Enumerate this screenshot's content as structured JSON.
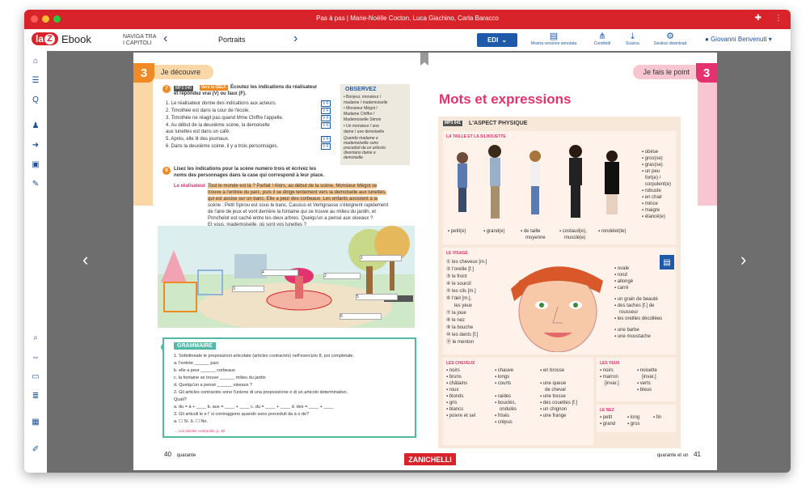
{
  "window": {
    "title": "Pas à pas | Marie-Noëlle Cocton, Luca Giachino, Carla Baracco"
  },
  "appbar": {
    "logo_la": "la",
    "logo_z": "Z",
    "logo_ebook": "Ebook",
    "nav_label_line1": "NAVIGA TRA",
    "nav_label_line2": "I CAPITOLI",
    "chapter": "Portraits",
    "edi_label": "EDI",
    "tools": [
      "Mostra versione annotata",
      "Condividi",
      "Scarica",
      "Gestisci download"
    ],
    "user": "Giovanni Benvenuti"
  },
  "left_page": {
    "chip_num": "3",
    "chip_label": "Je découvre",
    "page_num": "40",
    "page_word": "quarante",
    "q7_num": "7",
    "q7_tag": "MP3 040",
    "q7_tag2": "Vers le DELF",
    "q7_title_a": "Écoutez les indications du réalisateur",
    "q7_title_b": "et répondez vrai (V) ou faux (F).",
    "q7_items": [
      "1.  Le réalisateur donne des indications aux acteurs.",
      "2.  Timothée est dans la cour de l'école.",
      "3.  Timothée ne réagit pas quand Mme Chiffre l'appelle.",
      "4.  Au début de la deuxième scène, la demoiselle",
      "     aux lunettes est dans un café.",
      "5.  Après, elle lit des journaux.",
      "6.  Dans la deuxième scène, il y a trois personnages."
    ],
    "vf": "V F",
    "observez_title": "OBSERVEZ",
    "observez_items": [
      "• Bonjeur, monsieur /",
      "  madame / mademoiselle",
      "• Monsieur Mégot /",
      "  Madame Chiffre /",
      "  Mademoiselle Simon",
      "• Un monsieur / une",
      "  dame / une demoiselle",
      "  Quando madame e",
      "  mademoiselle sono",
      "  preceduti da un articolo",
      "  diventano dame e",
      "  demoiselle"
    ],
    "q8_num": "8",
    "q8_title_a": "Lisez les indications pour la scène numéro trois et écrivez les",
    "q8_title_b": "noms des personnages dans la case qui correspond à leur place.",
    "realisateur": "Le réalisateur",
    "q8_text": [
      "Tout le monde est là ? Parfait ! Alors, au début de la scène, Monsieur Mégot se",
      "trouve à l'entrée du parc, puis il se dirige lentement vers la demoiselle aux lunettes,",
      "qui est assise sur un banc. Elle a peur des corbeaux. Les enfants assistent à la",
      "scène : Petit Spirou est sous le banc, Cassius et Vertignasse s'éloignent rapidement",
      "de l'aire de jeux et vont derrière la fontaine qui se trouve au milieu du jardin, et",
      "Ponchelot est caché entre les deux arbres. Quelqu'un a pensé aux oiseaux ?",
      "Et vous, mademoiselle, où sont vos lunettes ?"
    ],
    "illus_boxes": [
      "1",
      "2",
      "3",
      "4",
      "5",
      "6"
    ],
    "q9_num": "9",
    "grammaire_title": "GRAMMAIRE",
    "g_lines": [
      "1.  Sottolineate le preposizioni articolate (articles contractés) nell'esercizio 8, poi completate.",
      "     a.  l'entrée ______ parc",
      "     b.  elle a peur ______ corbeaux",
      "     c.  la fontaine se trouve ______ milieu du jardin",
      "     d.  Quelqu'un a pensé ______ oiseaux ?",
      "2.  Gli articles contractés sono l'unione di una preposizione e di un articolo determinativo.",
      "     Quali?",
      "     a.  du = à + ____     b.  aux = ____ + ____     c.  du = ____ + ____     d.  des = ____ + ____",
      "3.  Gli articoli le e l' si contraggono quando sono preceduti da à o de?",
      "     a.  ☐ Sì.         b.  ☐ No."
    ],
    "g_ref": "→ Les articles contractés, p. 46"
  },
  "right_page": {
    "chip_num": "3",
    "chip_label": "Je fais le point",
    "page_num": "41",
    "page_word": "quarante et un",
    "title": "Mots et expressions",
    "aspect_tag": "MP3 041",
    "aspect_title": "L'ASPECT PHYSIQUE",
    "taille_title": "LA TAILLE ET LA SILHOUETTE",
    "taille_labels": [
      "petit(e)",
      "grand(e)",
      "de taille",
      "moyenne",
      "costaud(e),",
      "musclé(e)",
      "rondelet(te)"
    ],
    "silhouette_list": [
      "obèse",
      "gros(se)",
      "gras(se)",
      "un peu",
      "fort(e) /",
      "corpulent(e)",
      "robuste",
      "en chair",
      "mince",
      "maigre",
      "élancé(e)"
    ],
    "visage_title": "LE VISAGE",
    "visage_list": [
      "les cheveux [m.]",
      "l'oreille [f.]",
      "le front",
      "le sourcil",
      "les cils [m.]",
      "l'œil [m.],",
      "les yeux",
      "la joue",
      "le nez",
      "la bouche",
      "les dents [f.]",
      "le menton"
    ],
    "visage_list_right": [
      "ovale",
      "rond",
      "allongé",
      "carré",
      "un grain de beauté",
      "des taches [f.] de",
      "rousseur",
      "les oreilles décollées",
      "une barbe",
      "une moustache"
    ],
    "cheveux_title": "LES CHEVEUX",
    "cheveux_col1": [
      "noirs",
      "bruns",
      "châtains",
      "roux",
      "blonds",
      "gris",
      "blancs",
      "poivre et sel"
    ],
    "cheveux_col2": [
      "chauve",
      "longs",
      "courts",
      "raides",
      "bouclés,",
      "ondulés",
      "frisés",
      "crépus"
    ],
    "cheveux_col3": [
      "en brosse",
      "une queue",
      "de cheval",
      "une tresse",
      "des couettes [f.]",
      "un chignon",
      "une frange"
    ],
    "yeux_title": "LES YEUX",
    "yeux_col1": [
      "noirs",
      "marron",
      "[invar.]"
    ],
    "yeux_col2": [
      "noisette",
      "[invar.]",
      "verts",
      "bleus"
    ],
    "nez_title": "LE NEZ",
    "nez_items": [
      "petit",
      "grand",
      "long",
      "gros",
      "fin"
    ]
  },
  "footer": {
    "publisher": "ZANICHELLI"
  },
  "colors": {
    "brand_red": "#d8232a",
    "accent_blue": "#1e5aa8",
    "orange": "#f08a24",
    "pink": "#e2336e",
    "teal": "#52b9a6"
  },
  "icons": {
    "sidebar": [
      "home-icon",
      "list-icon",
      "search-text-icon",
      "users-icon",
      "arrow-icon",
      "book-icon",
      "pen-icon",
      "search-icon",
      "fit-width-icon",
      "page-icon",
      "page-list-icon",
      "grid-icon",
      "edit-page-icon"
    ]
  }
}
